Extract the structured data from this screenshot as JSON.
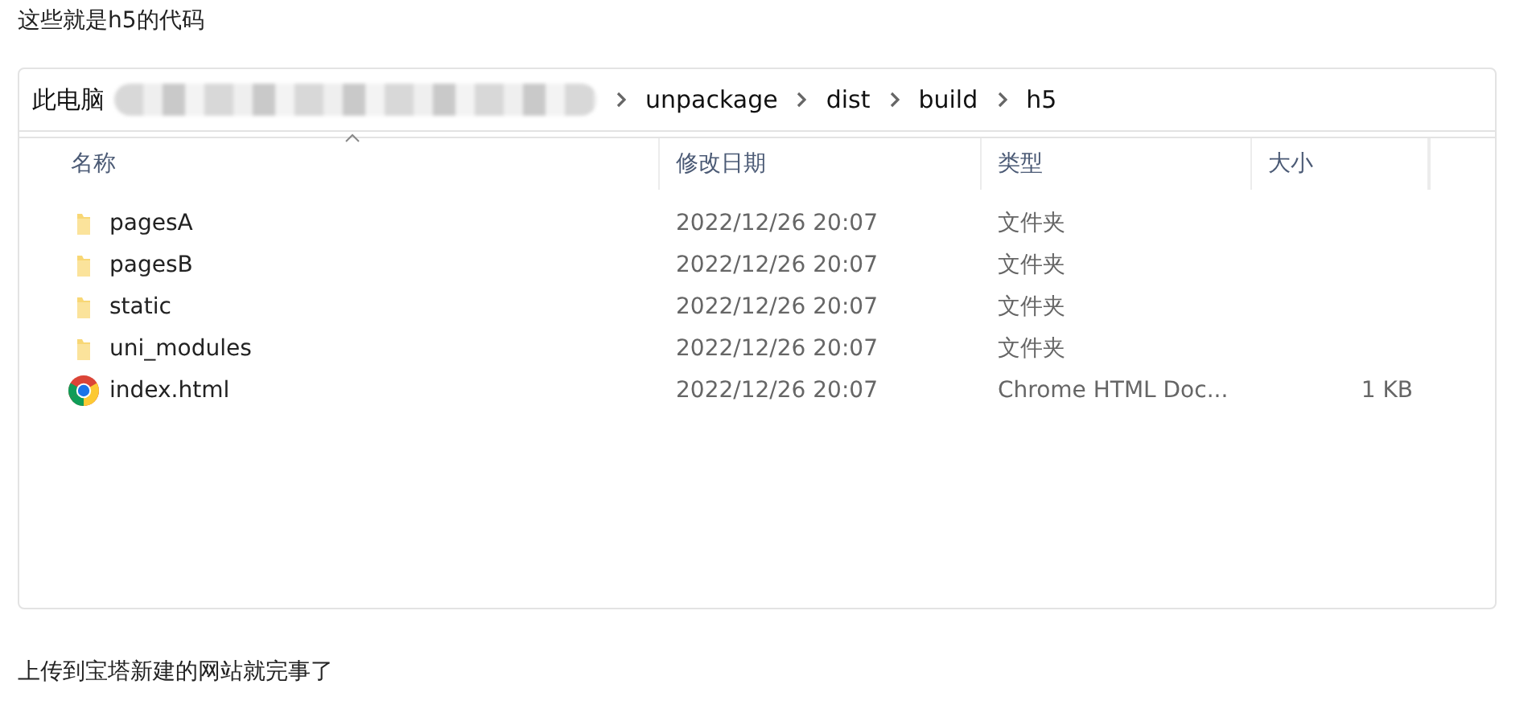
{
  "intro_text": "这些就是h5的代码",
  "explorer": {
    "breadcrumb": [
      {
        "label": "此电脑",
        "kind": "text"
      },
      {
        "kind": "redacted"
      },
      {
        "label": "unpackage",
        "kind": "text"
      },
      {
        "label": "dist",
        "kind": "text"
      },
      {
        "label": "build",
        "kind": "text"
      },
      {
        "label": "h5",
        "kind": "text"
      }
    ],
    "columns": [
      "名称",
      "修改日期",
      "类型",
      "大小"
    ],
    "rows": [
      {
        "name": "pagesA",
        "date": "2022/12/26 20:07",
        "type": "文件夹",
        "kind": "folder"
      },
      {
        "name": "pagesB",
        "date": "2022/12/26 20:07",
        "type": "文件夹",
        "kind": "folder"
      },
      {
        "name": "static",
        "date": "2022/12/26 20:07",
        "type": "文件夹",
        "kind": "folder"
      },
      {
        "name": "uni_modules",
        "date": "2022/12/26 20:07",
        "type": "文件夹",
        "kind": "folder"
      },
      {
        "name": "index.html",
        "date": "2022/12/26 20:07",
        "type": "Chrome HTML Doc...",
        "size": "1 KB",
        "kind": "chrome"
      }
    ]
  },
  "outro_text": "上传到宝塔新建的网站就完事了"
}
